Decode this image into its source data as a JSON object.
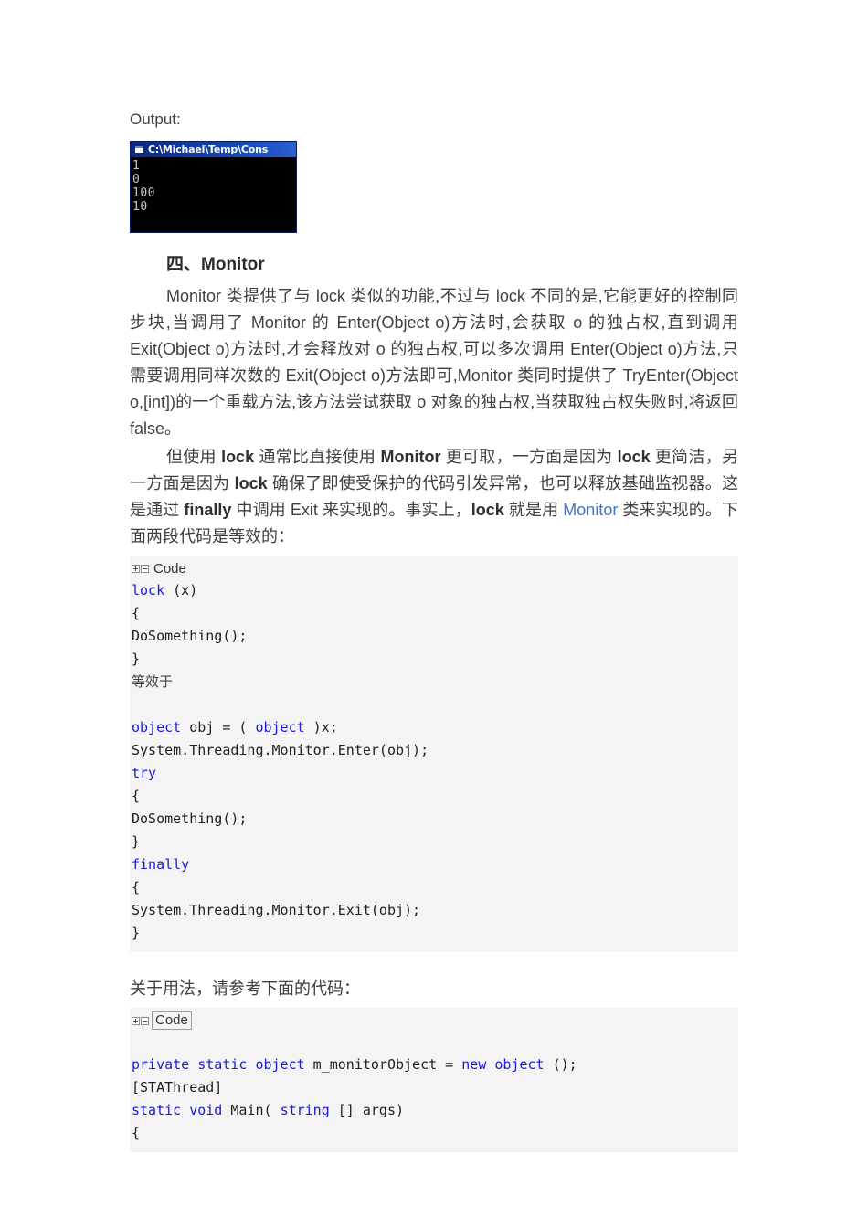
{
  "document": {
    "output_label": "Output:",
    "console": {
      "title": "C:\\Michael\\Temp\\Cons",
      "icon": "console-window-icon",
      "lines": [
        "1",
        "0",
        "100",
        "10"
      ]
    },
    "heading": {
      "number": "四、",
      "text": "Monitor"
    },
    "paragraph1": "Monitor 类提供了与 lock 类似的功能,不过与 lock 不同的是,它能更好的控制同步块,当调用了 Monitor 的 Enter(Object o)方法时,会获取 o 的独占权,直到调用 Exit(Object o)方法时,才会释放对 o 的独占权,可以多次调用 Enter(Object o)方法,只需要调用同样次数的 Exit(Object o)方法即可,Monitor 类同时提供了 TryEnter(Object o,[int])的一个重载方法,该方法尝试获取 o 对象的独占权,当获取独占权失败时,将返回 false。",
    "paragraph2": {
      "part1": "但使用 ",
      "bold1": "lock",
      "part2": " 通常比直接使用 ",
      "bold2": "Monitor",
      "part3": " 更可取，一方面是因为 ",
      "bold3": "lock",
      "part4": " 更简洁，另一方面是因为 ",
      "bold4": "lock",
      "part5": " 确保了即使受保护的代码引发异常，也可以释放基础监视器。这是通过 ",
      "bold5": "finally",
      "part6": " 中调用 Exit 来实现的。事实上，",
      "bold6": "lock",
      "part7": " 就是用 ",
      "link": "Monitor",
      "part8": " 类来实现的。下面两段代码是等效的："
    },
    "code_block_1": {
      "label": "Code",
      "expand_icon": "expand-plus-icon",
      "collapse_icon": "collapse-minus-icon",
      "lines": [
        {
          "segments": [
            {
              "t": "lock",
              "k": true
            },
            {
              "t": " (x)",
              "k": false
            }
          ]
        },
        {
          "segments": [
            {
              "t": "{",
              "k": false
            }
          ]
        },
        {
          "segments": [
            {
              "t": "DoSomething();",
              "k": false
            }
          ]
        },
        {
          "segments": [
            {
              "t": "}",
              "k": false
            }
          ]
        },
        {
          "cjk": true,
          "segments": [
            {
              "t": "等效于",
              "k": false
            }
          ]
        },
        {
          "segments": [
            {
              "t": "",
              "k": false
            }
          ]
        },
        {
          "segments": [
            {
              "t": "object",
              "k": true
            },
            {
              "t": " obj = ( ",
              "k": false
            },
            {
              "t": "object",
              "k": true
            },
            {
              "t": " )x;",
              "k": false
            }
          ]
        },
        {
          "segments": [
            {
              "t": "System.Threading.Monitor.Enter(obj);",
              "k": false
            }
          ]
        },
        {
          "segments": [
            {
              "t": "try",
              "k": true
            }
          ]
        },
        {
          "segments": [
            {
              "t": "{",
              "k": false
            }
          ]
        },
        {
          "segments": [
            {
              "t": "DoSomething();",
              "k": false
            }
          ]
        },
        {
          "segments": [
            {
              "t": "}",
              "k": false
            }
          ]
        },
        {
          "segments": [
            {
              "t": "finally",
              "k": true
            }
          ]
        },
        {
          "segments": [
            {
              "t": "{",
              "k": false
            }
          ]
        },
        {
          "segments": [
            {
              "t": "System.Threading.Monitor.Exit(obj);",
              "k": false
            }
          ]
        },
        {
          "segments": [
            {
              "t": "}",
              "k": false
            }
          ]
        }
      ]
    },
    "usage_note": "关于用法，请参考下面的代码：",
    "code_block_2": {
      "label": "Code",
      "expand_icon": "expand-plus-icon",
      "collapse_icon": "collapse-minus-icon",
      "lines": [
        {
          "segments": [
            {
              "t": "",
              "k": false
            }
          ]
        },
        {
          "segments": [
            {
              "t": "private static object",
              "k": true
            },
            {
              "t": " m_monitorObject = ",
              "k": false
            },
            {
              "t": "new object",
              "k": true
            },
            {
              "t": " ();",
              "k": false
            }
          ]
        },
        {
          "segments": [
            {
              "t": "[STAThread]",
              "k": false
            }
          ]
        },
        {
          "segments": [
            {
              "t": "static void",
              "k": true
            },
            {
              "t": " Main( ",
              "k": false
            },
            {
              "t": "string",
              "k": true
            },
            {
              "t": " [] args)",
              "k": false
            }
          ]
        },
        {
          "segments": [
            {
              "t": "{",
              "k": false
            }
          ]
        }
      ]
    },
    "colors": {
      "code_background": "#f4f4f5",
      "code_keyword": "#1a1ad6",
      "link": "#4472c4",
      "body_text": "#3f3f3f",
      "console_titlebar": "#12399c",
      "console_background": "#000000",
      "console_text": "#c8c8c8"
    }
  }
}
